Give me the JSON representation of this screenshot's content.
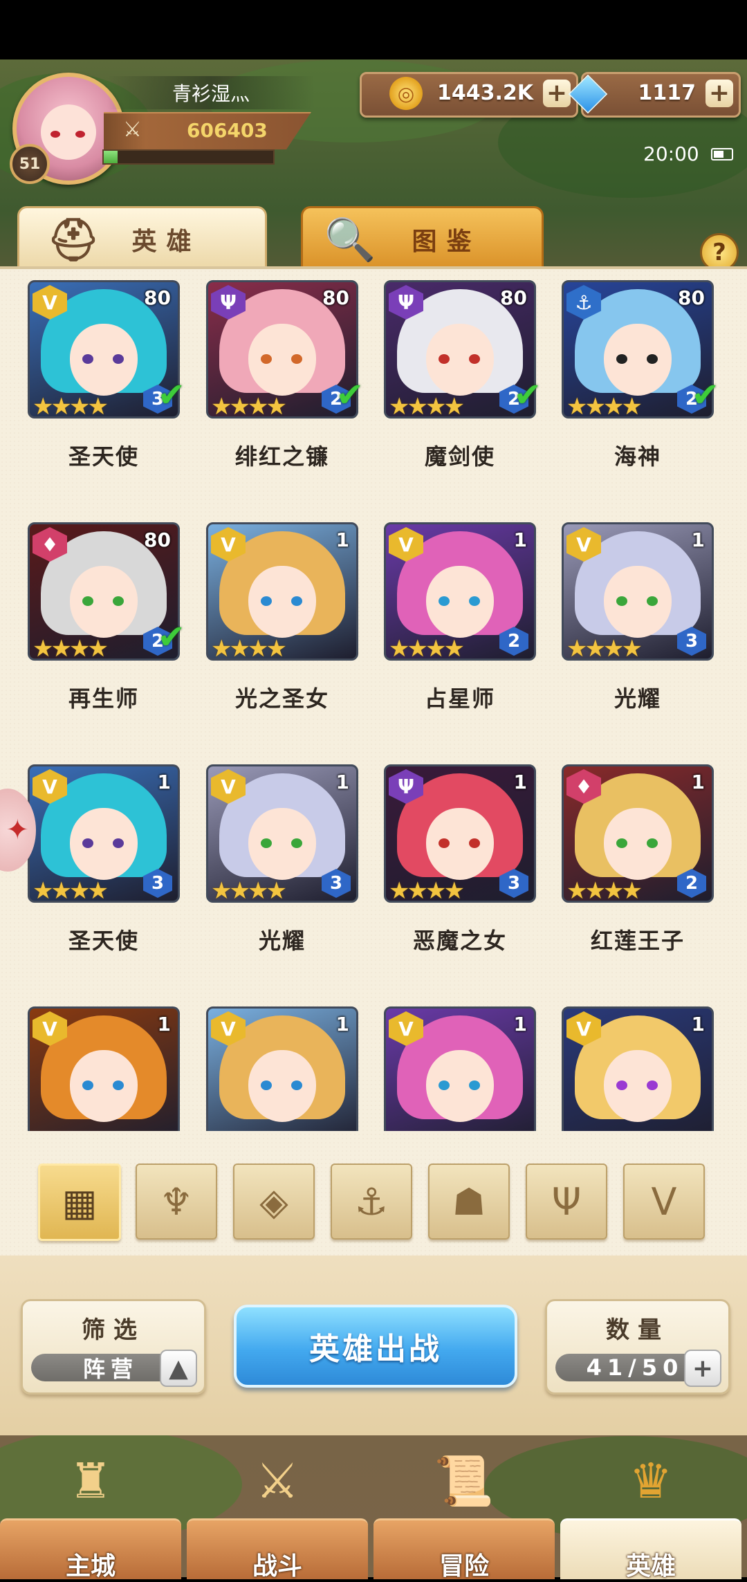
{
  "player": {
    "name": "青衫湿灬",
    "level": "51",
    "power": "606403",
    "exp_fraction": 0.08
  },
  "resources": {
    "gold": "1443.2K",
    "gems": "1117",
    "plus": "+"
  },
  "status": {
    "time": "20:00"
  },
  "tabs": {
    "heroes": "英雄",
    "codex": "图鉴",
    "help": "?"
  },
  "heroes": [
    {
      "name": "圣天使",
      "level": "80",
      "faction": "light",
      "stars": 4,
      "rank": "3",
      "checked": true
    },
    {
      "name": "绯红之镰",
      "level": "80",
      "faction": "dark",
      "stars": 4,
      "rank": "2",
      "checked": true
    },
    {
      "name": "魔剑使",
      "level": "80",
      "faction": "dark",
      "stars": 4,
      "rank": "2",
      "checked": true
    },
    {
      "name": "海神",
      "level": "80",
      "faction": "water",
      "stars": 4,
      "rank": "2",
      "checked": true
    },
    {
      "name": "再生师",
      "level": "80",
      "faction": "fire",
      "stars": 4,
      "rank": "2",
      "checked": true
    },
    {
      "name": "光之圣女",
      "level": "1",
      "faction": "light",
      "stars": 4,
      "rank": "",
      "checked": false
    },
    {
      "name": "占星师",
      "level": "1",
      "faction": "light",
      "stars": 4,
      "rank": "2",
      "checked": false
    },
    {
      "name": "光耀",
      "level": "1",
      "faction": "light",
      "stars": 4,
      "rank": "3",
      "checked": false
    },
    {
      "name": "圣天使",
      "level": "1",
      "faction": "light",
      "stars": 4,
      "rank": "3",
      "checked": false
    },
    {
      "name": "光耀",
      "level": "1",
      "faction": "light",
      "stars": 4,
      "rank": "3",
      "checked": false
    },
    {
      "name": "恶魔之女",
      "level": "1",
      "faction": "dark",
      "stars": 4,
      "rank": "3",
      "checked": false
    },
    {
      "name": "红莲王子",
      "level": "1",
      "faction": "fire",
      "stars": 4,
      "rank": "2",
      "checked": false
    },
    {
      "name": "",
      "level": "1",
      "faction": "light",
      "stars": 0,
      "rank": "",
      "checked": false
    },
    {
      "name": "",
      "level": "1",
      "faction": "light",
      "stars": 0,
      "rank": "",
      "checked": false
    },
    {
      "name": "",
      "level": "1",
      "faction": "light",
      "stars": 0,
      "rank": "",
      "checked": false
    },
    {
      "name": "",
      "level": "1",
      "faction": "light",
      "stars": 0,
      "rank": "",
      "checked": false
    }
  ],
  "filters": [
    "all-grid-icon",
    "nature-faction-icon",
    "earth-faction-icon",
    "anchor-faction-icon",
    "beast-faction-icon",
    "dark-faction-icon",
    "light-faction-icon"
  ],
  "filter_box": {
    "title": "筛选",
    "value": "阵营"
  },
  "deploy": {
    "label": "英雄出战"
  },
  "count_box": {
    "title": "数量",
    "value": "41/50"
  },
  "nav": [
    {
      "label": "主城",
      "icon": "castle-icon"
    },
    {
      "label": "战斗",
      "icon": "crossed-swords-icon"
    },
    {
      "label": "冒险",
      "icon": "map-scroll-icon"
    },
    {
      "label": "英雄",
      "icon": "hero-crest-icon"
    }
  ],
  "colors": {
    "light": "#e9b92d",
    "dark": "#7a3fb8",
    "water": "#2f6fc9",
    "fire": "#d2406a"
  }
}
